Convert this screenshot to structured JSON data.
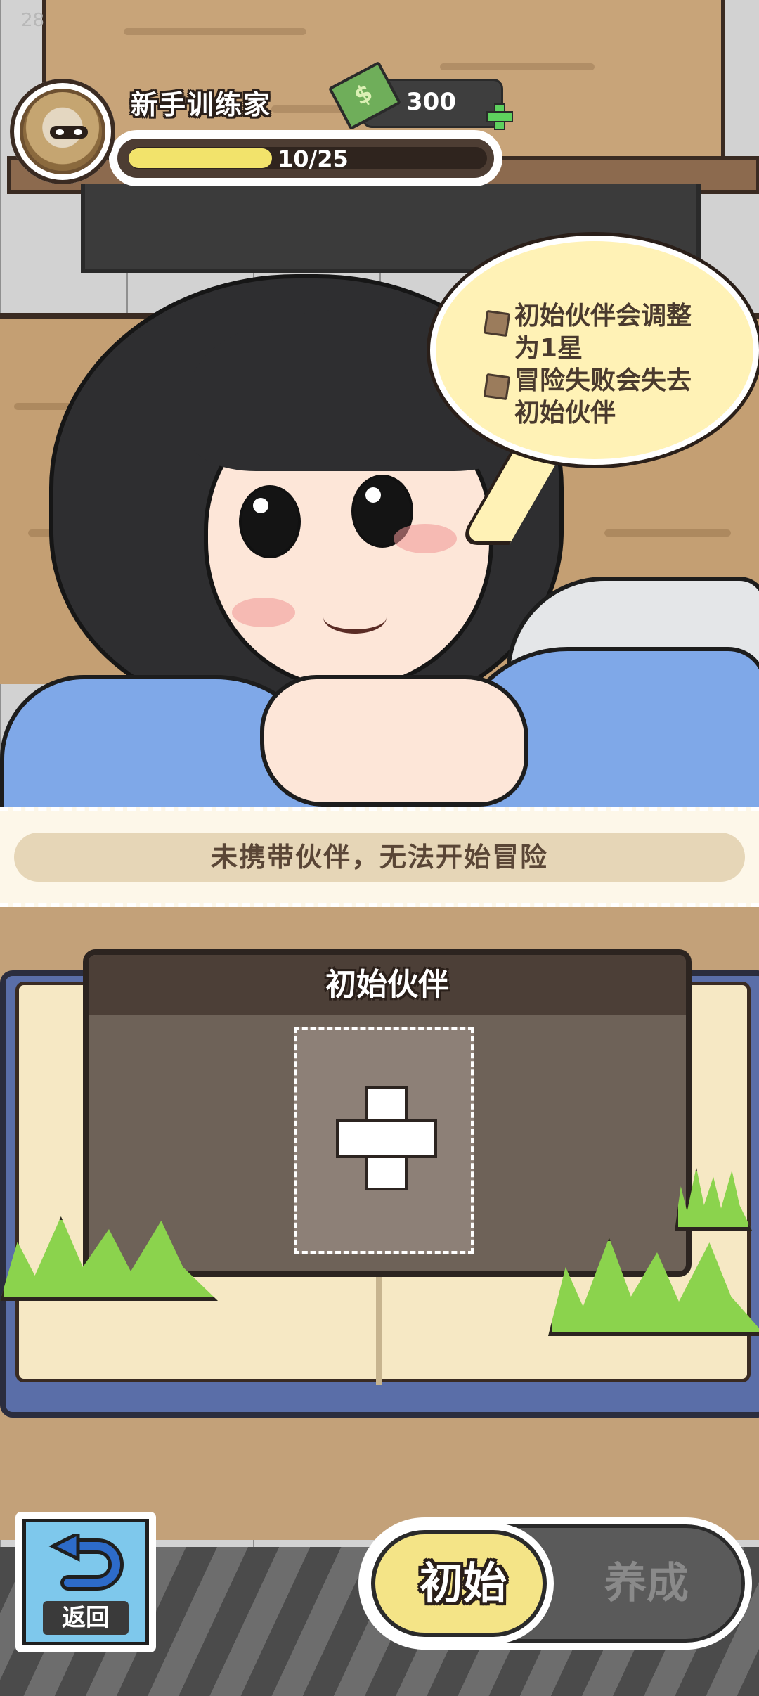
{
  "status": {
    "fps": "28"
  },
  "player": {
    "name": "新手训练家",
    "xp_text": "10/25",
    "xp_fraction": 0.4,
    "money": "300"
  },
  "icons": {
    "avatar": "owl-avatar-icon",
    "money": "cash-icon",
    "add_money": "plus-icon",
    "bullet": "bullet-icon",
    "slot_add": "plus-icon",
    "back": "return-arrow-icon"
  },
  "bubble": {
    "lines": [
      "初始伙伴会调整",
      "为1星",
      "冒险失败会失去",
      "初始伙伴"
    ]
  },
  "notice": {
    "text": "未携带伙伴，无法开始冒险"
  },
  "panel": {
    "title": "初始伙伴"
  },
  "nav": {
    "back_label": "返回",
    "tabs": [
      {
        "label": "初始",
        "active": true
      },
      {
        "label": "养成",
        "active": false
      }
    ]
  },
  "colors": {
    "accent_yellow": "#f4e487",
    "xp_fill": "#f2e36b",
    "money_green": "#5ed15e",
    "bubble": "#fff2b6",
    "sleeve_blue": "#7fa8e8"
  }
}
